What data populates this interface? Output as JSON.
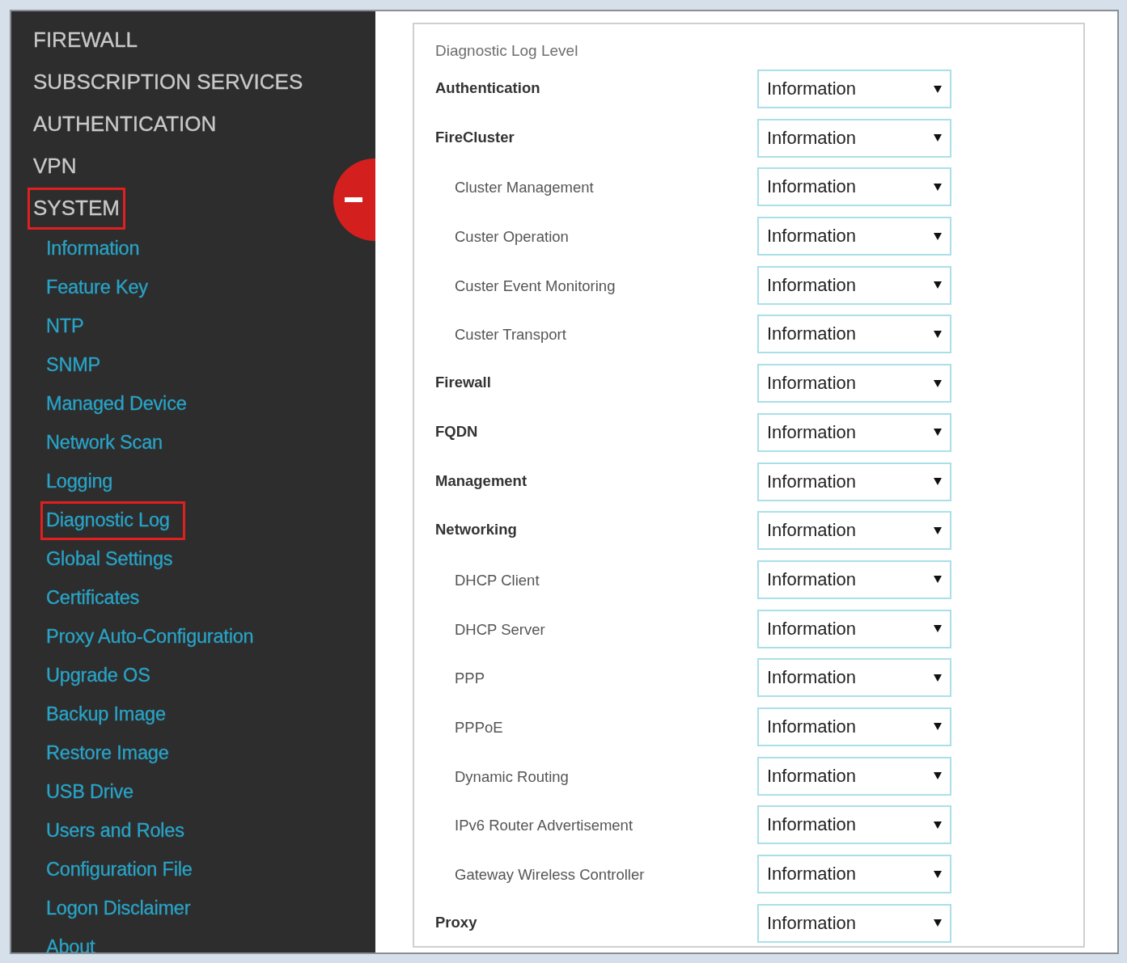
{
  "sidebar": {
    "collapse_button": {
      "expanded": true
    },
    "items": [
      {
        "label": "FIREWALL",
        "highlighted": false
      },
      {
        "label": "SUBSCRIPTION SERVICES",
        "highlighted": false
      },
      {
        "label": "AUTHENTICATION",
        "highlighted": false
      },
      {
        "label": "VPN",
        "highlighted": false
      },
      {
        "label": "SYSTEM",
        "highlighted": true,
        "children": [
          {
            "label": "Information",
            "highlighted": false
          },
          {
            "label": "Feature Key",
            "highlighted": false
          },
          {
            "label": "NTP",
            "highlighted": false
          },
          {
            "label": "SNMP",
            "highlighted": false
          },
          {
            "label": "Managed Device",
            "highlighted": false
          },
          {
            "label": "Network Scan",
            "highlighted": false
          },
          {
            "label": "Logging",
            "highlighted": false
          },
          {
            "label": "Diagnostic Log",
            "highlighted": true
          },
          {
            "label": "Global Settings",
            "highlighted": false
          },
          {
            "label": "Certificates",
            "highlighted": false
          },
          {
            "label": "Proxy Auto-Configuration",
            "highlighted": false
          },
          {
            "label": "Upgrade OS",
            "highlighted": false
          },
          {
            "label": "Backup Image",
            "highlighted": false
          },
          {
            "label": "Restore Image",
            "highlighted": false
          },
          {
            "label": "USB Drive",
            "highlighted": false
          },
          {
            "label": "Users and Roles",
            "highlighted": false
          },
          {
            "label": "Configuration File",
            "highlighted": false
          },
          {
            "label": "Logon Disclaimer",
            "highlighted": false
          },
          {
            "label": "About",
            "highlighted": false
          }
        ]
      }
    ]
  },
  "settings": {
    "title": "Diagnostic Log Level",
    "categories": [
      {
        "label": "Authentication",
        "value": "Information"
      },
      {
        "label": "FireCluster",
        "value": "Information",
        "children": [
          {
            "label": "Cluster Management",
            "value": "Information"
          },
          {
            "label": "Custer Operation",
            "value": "Information"
          },
          {
            "label": "Custer Event Monitoring",
            "value": "Information"
          },
          {
            "label": "Custer Transport",
            "value": "Information"
          }
        ]
      },
      {
        "label": "Firewall",
        "value": "Information"
      },
      {
        "label": "FQDN",
        "value": "Information"
      },
      {
        "label": "Management",
        "value": "Information"
      },
      {
        "label": "Networking",
        "value": "Information",
        "children": [
          {
            "label": "DHCP Client",
            "value": "Information"
          },
          {
            "label": "DHCP Server",
            "value": "Information"
          },
          {
            "label": "PPP",
            "value": "Information"
          },
          {
            "label": "PPPoE",
            "value": "Information"
          },
          {
            "label": "Dynamic Routing",
            "value": "Information"
          },
          {
            "label": "IPv6 Router Advertisement",
            "value": "Information"
          },
          {
            "label": "Gateway Wireless Controller",
            "value": "Information"
          }
        ]
      },
      {
        "label": "Proxy",
        "value": "Information"
      }
    ]
  }
}
